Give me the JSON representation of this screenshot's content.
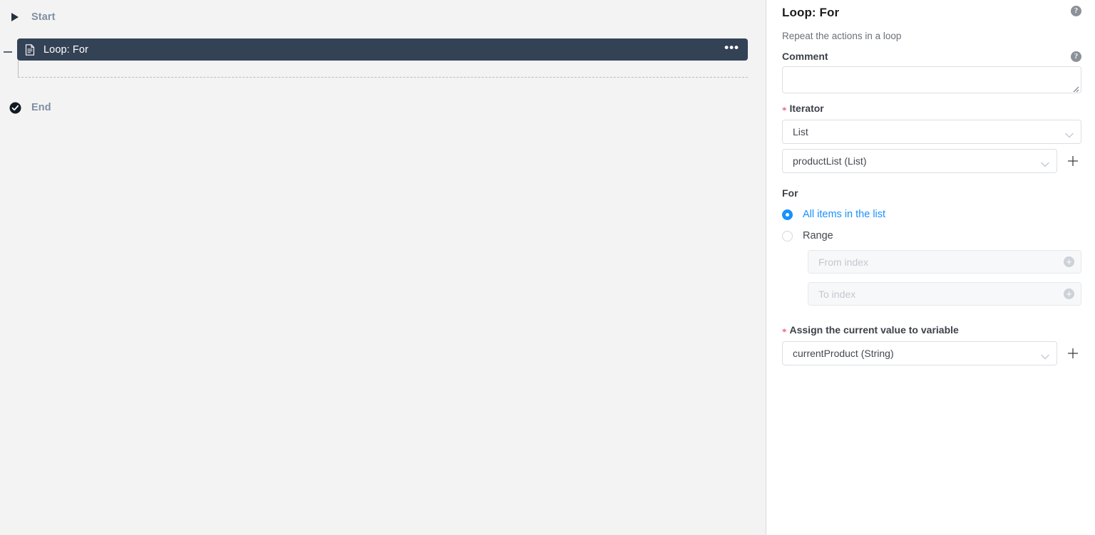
{
  "canvas": {
    "nodes": [
      {
        "label": "Start",
        "icon": "play-triangle-icon"
      },
      {
        "label": "End",
        "icon": "check-circle-icon"
      }
    ],
    "loop_node": {
      "title": "Loop: For",
      "icon": "document-icon",
      "menu_label": "•••",
      "collapse_label": "—"
    }
  },
  "panel": {
    "title": "Loop: For",
    "help_label": "?",
    "description": "Repeat the actions in a loop",
    "comment": {
      "label": "Comment",
      "value": "",
      "placeholder": ""
    },
    "iterator": {
      "label": "Iterator",
      "required_marker": "*",
      "type_value": "List",
      "source_value": "productList (List)",
      "add_label": "+"
    },
    "for_section": {
      "label": "For",
      "options": [
        {
          "label": "All items in the list",
          "selected": true
        },
        {
          "label": "Range",
          "selected": false
        }
      ],
      "range": {
        "from_placeholder": "From index",
        "from_value": "",
        "to_placeholder": "To index",
        "to_value": "",
        "badge_label": "+"
      }
    },
    "assign": {
      "label": "Assign the current value to variable",
      "required_marker": "*",
      "value": "currentProduct (String)",
      "add_label": "+"
    }
  },
  "colors": {
    "node_bar": "#344256",
    "accent": "#1890ff",
    "required": "#e8607a",
    "canvas_bg": "#f3f3f4"
  }
}
